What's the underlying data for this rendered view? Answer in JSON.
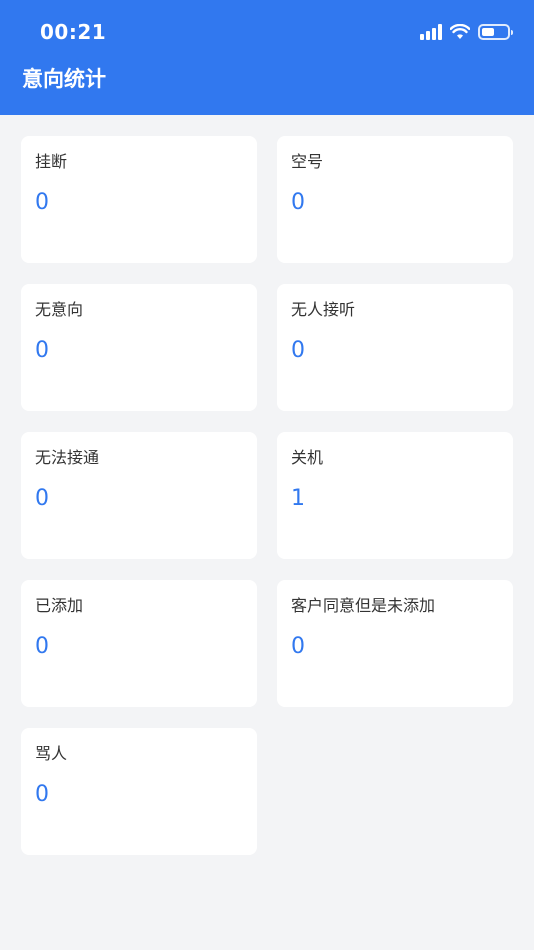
{
  "status_bar": {
    "time": "00:21",
    "battery_level": 0.5
  },
  "header": {
    "title": "意向统计"
  },
  "colors": {
    "accent": "#3178ef",
    "background": "#f3f4f6",
    "card": "#ffffff"
  },
  "stats": [
    {
      "label": "挂断",
      "value": "0"
    },
    {
      "label": "空号",
      "value": "0"
    },
    {
      "label": "无意向",
      "value": "0"
    },
    {
      "label": "无人接听",
      "value": "0"
    },
    {
      "label": "无法接通",
      "value": "0"
    },
    {
      "label": "关机",
      "value": "1"
    },
    {
      "label": "已添加",
      "value": "0"
    },
    {
      "label": "客户同意但是未添加",
      "value": "0"
    },
    {
      "label": "骂人",
      "value": "0"
    }
  ]
}
